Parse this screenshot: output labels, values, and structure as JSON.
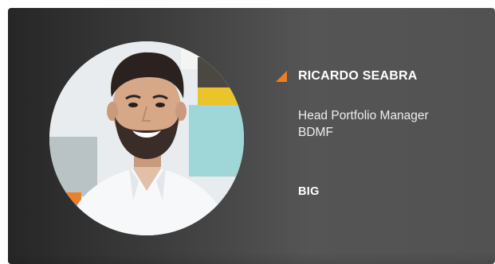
{
  "profile": {
    "name": "RICARDO SEABRA",
    "role_line_1": "Head Portfolio Manager",
    "role_line_2": "BDMF",
    "company": "BIG"
  },
  "colors": {
    "accent": "#ee7e22",
    "card_dark": "#262626",
    "card_light": "#555555",
    "text": "#ffffff"
  },
  "icons": {
    "name_marker": "orange-triangle-icon"
  }
}
